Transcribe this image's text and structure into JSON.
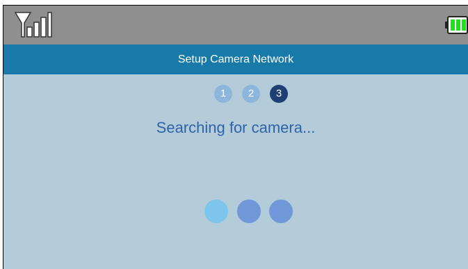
{
  "status_bar": {
    "signal_icon": "signal-strength-icon",
    "battery_icon": "battery-icon",
    "colors": {
      "background": "#8f8f8f",
      "battery_fill": "#22dd22"
    }
  },
  "header": {
    "title": "Setup Camera Network",
    "color": "#187aa8"
  },
  "steps": [
    {
      "number": "1",
      "state": "completed"
    },
    {
      "number": "2",
      "state": "completed"
    },
    {
      "number": "3",
      "state": "current"
    }
  ],
  "status_message": "Searching for camera...",
  "loading_indicator": {
    "dot_count": 3,
    "colors": [
      "#7dc5ea",
      "#7098d8",
      "#7098d8"
    ]
  },
  "colors": {
    "content_background": "#b4ccda",
    "step_inactive": "#8cb6dc",
    "step_active": "#1d3f74",
    "message_text": "#2f63a7"
  }
}
